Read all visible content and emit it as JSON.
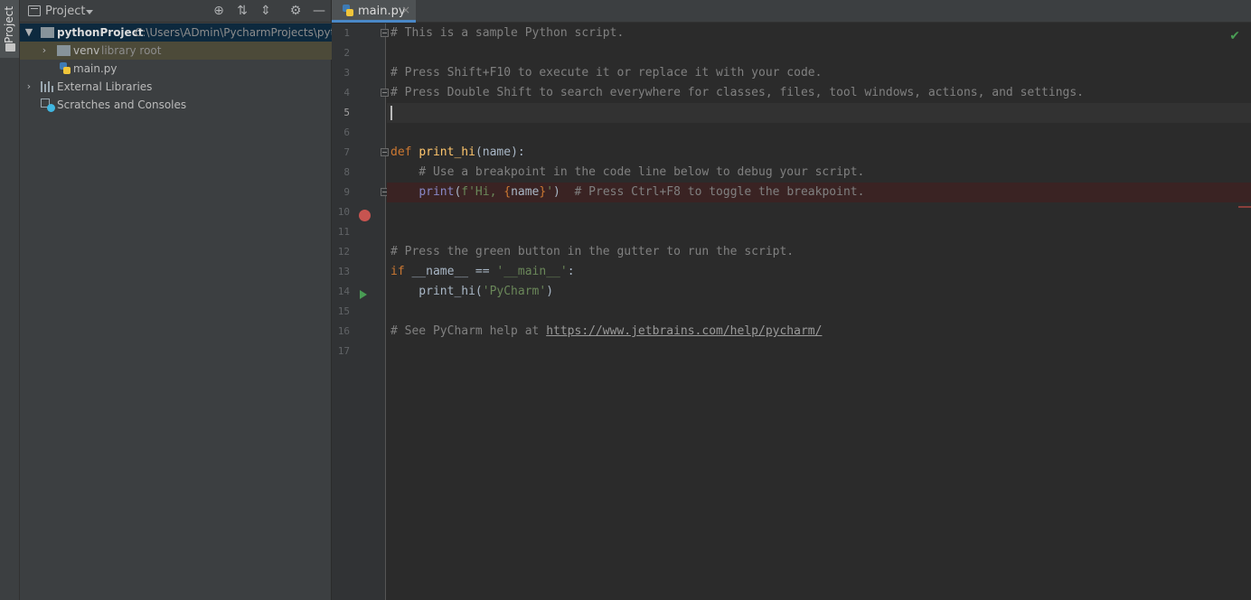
{
  "sidebar_strip": {
    "label": "Project"
  },
  "project_panel": {
    "title": "Project",
    "tree": {
      "root": {
        "name": "pythonProject",
        "path": "C:\\Users\\ADmin\\PycharmProjects\\pyt"
      },
      "venv": {
        "name": "venv",
        "hint": "library root"
      },
      "main": {
        "name": "main.py"
      },
      "external": {
        "name": "External Libraries"
      },
      "scratches": {
        "name": "Scratches and Consoles"
      }
    }
  },
  "editor": {
    "tab_label": "main.py",
    "tab_close": "×",
    "current_line": 5,
    "line_numbers": [
      "1",
      "2",
      "3",
      "4",
      "5",
      "6",
      "7",
      "8",
      "9",
      "10",
      "11",
      "12",
      "13",
      "14",
      "15",
      "16",
      "17"
    ],
    "code": {
      "l1": "# This is a sample Python script.",
      "l3": "# Press Shift+F10 to execute it or replace it with your code.",
      "l4": "# Press Double Shift to search everywhere for classes, files, tool windows, actions, and settings.",
      "l7_kw": "def",
      "l7_fn": "print_hi",
      "l7_rest": "(name):",
      "l8": "    # Use a breakpoint in the code line below to debug your script.",
      "l9_indent": "    ",
      "l9_fn": "print",
      "l9_open": "(",
      "l9_f": "f'Hi, ",
      "l9_brace_open": "{",
      "l9_var": "name",
      "l9_brace_close": "}",
      "l9_str_end": "'",
      "l9_close": ")",
      "l9_comment": "  # Press Ctrl+F8 to toggle the breakpoint.",
      "l12": "# Press the green button in the gutter to run the script.",
      "l13_kw": "if",
      "l13_mid": " __name__ == ",
      "l13_str": "'__main__'",
      "l13_end": ":",
      "l14_pre": "    print_hi(",
      "l14_str": "'PyCharm'",
      "l14_end": ")",
      "l16_cmt": "# See PyCharm help at ",
      "l16_link": "https://www.jetbrains.com/help/pycharm/"
    },
    "inspection_status": "✔"
  },
  "colors": {
    "accent": "#4a88c7",
    "breakpoint": "#c75450",
    "run": "#499c54",
    "selection": "#0d293e"
  }
}
